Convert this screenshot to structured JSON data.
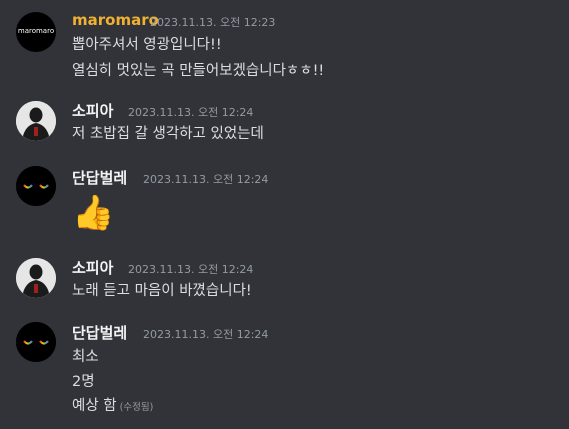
{
  "theme": {
    "background": "#313338",
    "text": "#dbdee1",
    "timestamp": "#949ba4",
    "accent_name": "#f0b132"
  },
  "messages": [
    {
      "author": "maromaro",
      "author_color": "#f0b132",
      "timestamp": "2023.11.13. 오전 12:23",
      "avatar_icon": "maromaro-logo-avatar",
      "avatar_text": "maromaro",
      "lines": [
        "뽑아주셔서 영광입니다!!",
        "열심히 멋있는 곡 만들어보겠습니다ㅎㅎ!!"
      ]
    },
    {
      "author": "소피아",
      "author_color": "#f2f3f5",
      "timestamp": "2023.11.13. 오전 12:24",
      "avatar_icon": "person-avatar",
      "lines": [
        "저 초밥집 갈 생각하고 있었는데"
      ]
    },
    {
      "author": "단답벌레",
      "author_color": "#f2f3f5",
      "timestamp": "2023.11.13. 오전 12:24",
      "avatar_icon": "rainbow-eyes-avatar",
      "lines": [],
      "emoji": "👍"
    },
    {
      "author": "소피아",
      "author_color": "#f2f3f5",
      "timestamp": "2023.11.13. 오전 12:24",
      "avatar_icon": "person-avatar",
      "lines": [
        "노래 듣고 마음이 바꼈습니다!"
      ]
    },
    {
      "author": "단답벌레",
      "author_color": "#f2f3f5",
      "timestamp": "2023.11.13. 오전 12:24",
      "avatar_icon": "rainbow-eyes-avatar",
      "lines": [
        "최소",
        "2명",
        "예상 함"
      ],
      "edited_label": "(수정됨)"
    }
  ]
}
